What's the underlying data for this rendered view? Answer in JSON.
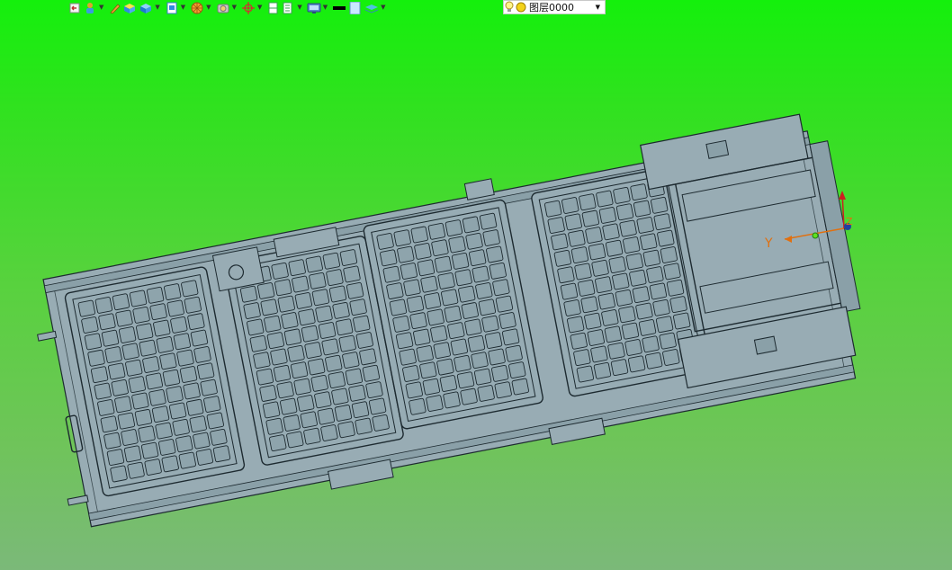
{
  "toolbar": {
    "icons": [
      "undo-arrow-icon",
      "person-icon",
      "pencil-icon",
      "box-yellow-icon",
      "cube-blue-icon",
      "document-icon",
      "wheel-orange-icon",
      "camera-icon",
      "crosshair-icon",
      "page-split-icon",
      "page-green-icon",
      "monitor-icon",
      "line-black-icon",
      "rect-lightblue-icon",
      "layers-icon"
    ]
  },
  "layer_combo": {
    "label": "图层0000",
    "icons": [
      "bulb-icon",
      "sun-icon"
    ]
  },
  "viewport": {
    "background_top": "#14f00c",
    "background_bottom": "#7bb979",
    "model_color": "#97acb4",
    "edge_color": "#1d2a30"
  },
  "triad": {
    "y_label": "Y",
    "z_label": "Z",
    "y_color": "#e07010",
    "x_color": "#cc2020",
    "z_color": "#2040a0"
  }
}
